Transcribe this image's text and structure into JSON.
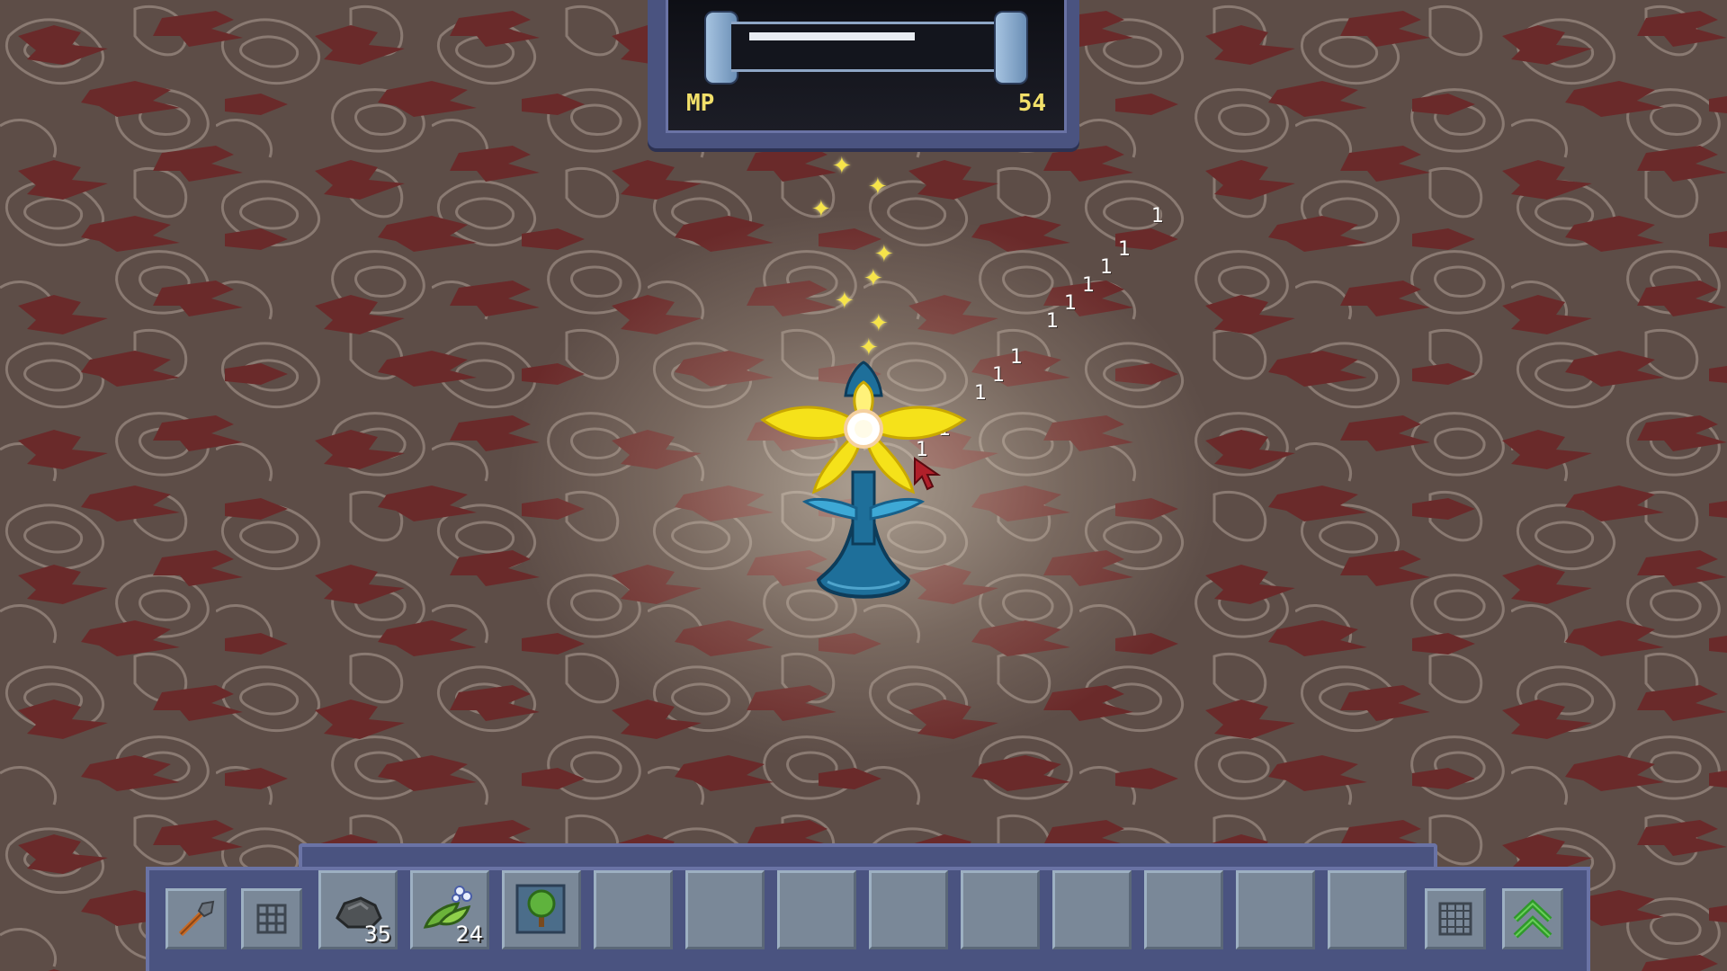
{
  "mp_panel": {
    "label": "MP",
    "value": "54",
    "fill_fraction": 0.6
  },
  "hotbar": {
    "left_buttons": [
      {
        "icon": "shovel-icon"
      },
      {
        "icon": "grid-icon"
      }
    ],
    "slots": [
      {
        "icon": "stone-icon",
        "count": "35"
      },
      {
        "icon": "leaf-bundle-icon",
        "count": "24"
      },
      {
        "icon": "tree-sapling-icon",
        "count": ""
      },
      {
        "icon": "",
        "count": ""
      },
      {
        "icon": "",
        "count": ""
      },
      {
        "icon": "",
        "count": ""
      },
      {
        "icon": "",
        "count": ""
      },
      {
        "icon": "",
        "count": ""
      },
      {
        "icon": "",
        "count": ""
      },
      {
        "icon": "",
        "count": ""
      },
      {
        "icon": "",
        "count": ""
      },
      {
        "icon": "",
        "count": ""
      }
    ],
    "right_buttons": [
      {
        "icon": "grid-icon"
      },
      {
        "icon": "double-chevron-up-icon"
      }
    ]
  },
  "damage_numbers": [
    "1",
    "1",
    "1",
    "1",
    "1",
    "1",
    "1",
    "1",
    "1",
    "1",
    "1"
  ],
  "colors": {
    "mp_text": "#f2e06a",
    "panel": "#4a5380",
    "slot": "#7a8898",
    "sparkle": "#f6e44a",
    "flower_petal": "#f5e21a",
    "flower_stem": "#1e6f9a"
  }
}
